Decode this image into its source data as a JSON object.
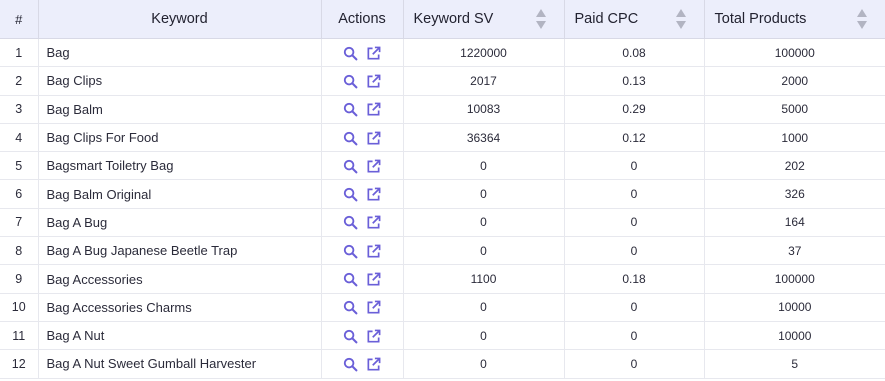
{
  "table": {
    "headers": {
      "num": "#",
      "keyword": "Keyword",
      "actions": "Actions",
      "keyword_sv": "Keyword SV",
      "paid_cpc": "Paid CPC",
      "total_products": "Total Products"
    },
    "accent_color": "#6a5fd8",
    "header_bg": "#eceefb",
    "rows": [
      {
        "num": "1",
        "keyword": "Bag",
        "sv": "1220000",
        "cpc": "0.08",
        "products": "100000"
      },
      {
        "num": "2",
        "keyword": "Bag Clips",
        "sv": "2017",
        "cpc": "0.13",
        "products": "2000"
      },
      {
        "num": "3",
        "keyword": "Bag Balm",
        "sv": "10083",
        "cpc": "0.29",
        "products": "5000"
      },
      {
        "num": "4",
        "keyword": "Bag Clips For Food",
        "sv": "36364",
        "cpc": "0.12",
        "products": "1000"
      },
      {
        "num": "5",
        "keyword": "Bagsmart Toiletry Bag",
        "sv": "0",
        "cpc": "0",
        "products": "202"
      },
      {
        "num": "6",
        "keyword": "Bag Balm Original",
        "sv": "0",
        "cpc": "0",
        "products": "326"
      },
      {
        "num": "7",
        "keyword": "Bag A Bug",
        "sv": "0",
        "cpc": "0",
        "products": "164"
      },
      {
        "num": "8",
        "keyword": "Bag A Bug Japanese Beetle Trap",
        "sv": "0",
        "cpc": "0",
        "products": "37"
      },
      {
        "num": "9",
        "keyword": "Bag Accessories",
        "sv": "1100",
        "cpc": "0.18",
        "products": "100000"
      },
      {
        "num": "10",
        "keyword": "Bag Accessories Charms",
        "sv": "0",
        "cpc": "0",
        "products": "10000"
      },
      {
        "num": "11",
        "keyword": "Bag A Nut",
        "sv": "0",
        "cpc": "0",
        "products": "10000"
      },
      {
        "num": "12",
        "keyword": "Bag A Nut Sweet Gumball Harvester",
        "sv": "0",
        "cpc": "0",
        "products": "5"
      }
    ]
  }
}
